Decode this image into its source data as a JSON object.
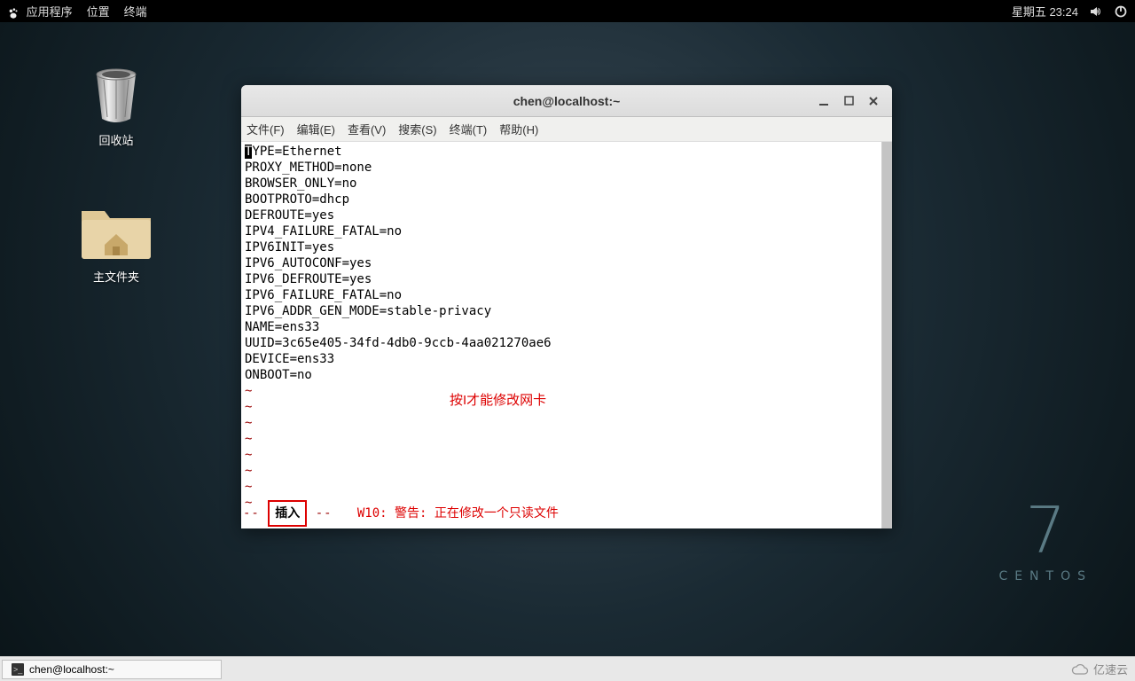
{
  "top_panel": {
    "apps": "应用程序",
    "places": "位置",
    "terminal": "终端",
    "clock": "星期五 23:24"
  },
  "desktop": {
    "trash_label": "回收站",
    "home_label": "主文件夹"
  },
  "window": {
    "title": "chen@localhost:~",
    "menu": {
      "file": "文件(F)",
      "edit": "编辑(E)",
      "view": "查看(V)",
      "search": "搜索(S)",
      "terminal": "终端(T)",
      "help": "帮助(H)"
    }
  },
  "terminal": {
    "cursor_char": "T",
    "line0_rest": "YPE=Ethernet",
    "lines": [
      "PROXY_METHOD=none",
      "BROWSER_ONLY=no",
      "BOOTPROTO=dhcp",
      "DEFROUTE=yes",
      "IPV4_FAILURE_FATAL=no",
      "IPV6INIT=yes",
      "IPV6_AUTOCONF=yes",
      "IPV6_DEFROUTE=yes",
      "IPV6_FAILURE_FATAL=no",
      "IPV6_ADDR_GEN_MODE=stable-privacy",
      "NAME=ens33",
      "UUID=3c65e405-34fd-4db0-9ccb-4aa021270ae6",
      "DEVICE=ens33",
      "ONBOOT=no"
    ],
    "annotation": "按I才能修改网卡",
    "status_dash": "-- ",
    "status_insert": "插入",
    "status_dash2": " --   ",
    "status_msg": "W10: 警告: 正在修改一个只读文件"
  },
  "centos": {
    "seven": "7",
    "name": "CENTOS"
  },
  "taskbar": {
    "item1": "chen@localhost:~"
  },
  "watermark": "亿速云"
}
